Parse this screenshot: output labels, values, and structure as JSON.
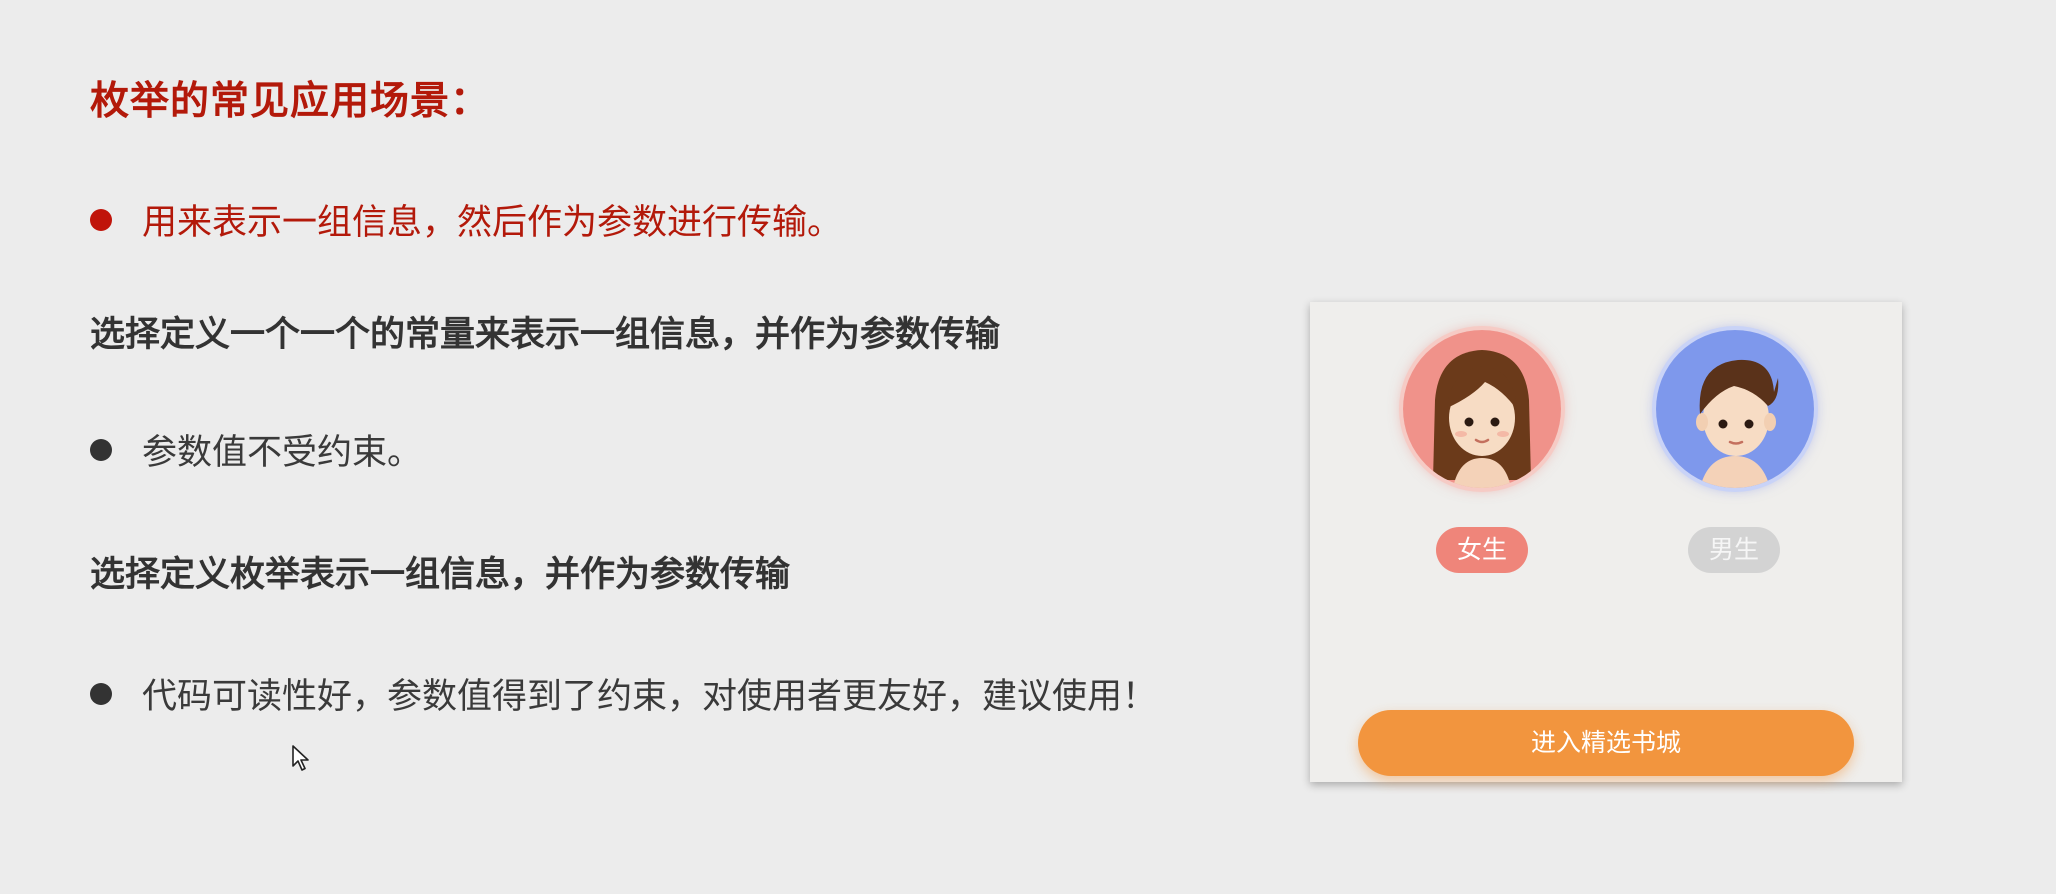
{
  "slide": {
    "heading": "枚举的常见应用场景：",
    "bullet1": "用来表示一组信息，然后作为参数进行传输。",
    "subheading1": "选择定义一个一个的常量来表示一组信息，并作为参数传输",
    "bullet2": "参数值不受约束。",
    "subheading2": "选择定义枚举表示一组信息，并作为参数传输",
    "bullet3": "代码可读性好，参数值得到了约束，对使用者更友好，建议使用！"
  },
  "panel": {
    "female_label": "女生",
    "male_label": "男生",
    "enter_button": "进入精选书城"
  },
  "colors": {
    "accent_red": "#b3190a",
    "female_pink": "#ef857a",
    "male_blue": "#7e98ec",
    "button_orange": "#f2953e"
  },
  "icons": {
    "female_avatar": "girl-avatar-icon",
    "male_avatar": "boy-avatar-icon",
    "cursor": "mouse-cursor-icon"
  }
}
